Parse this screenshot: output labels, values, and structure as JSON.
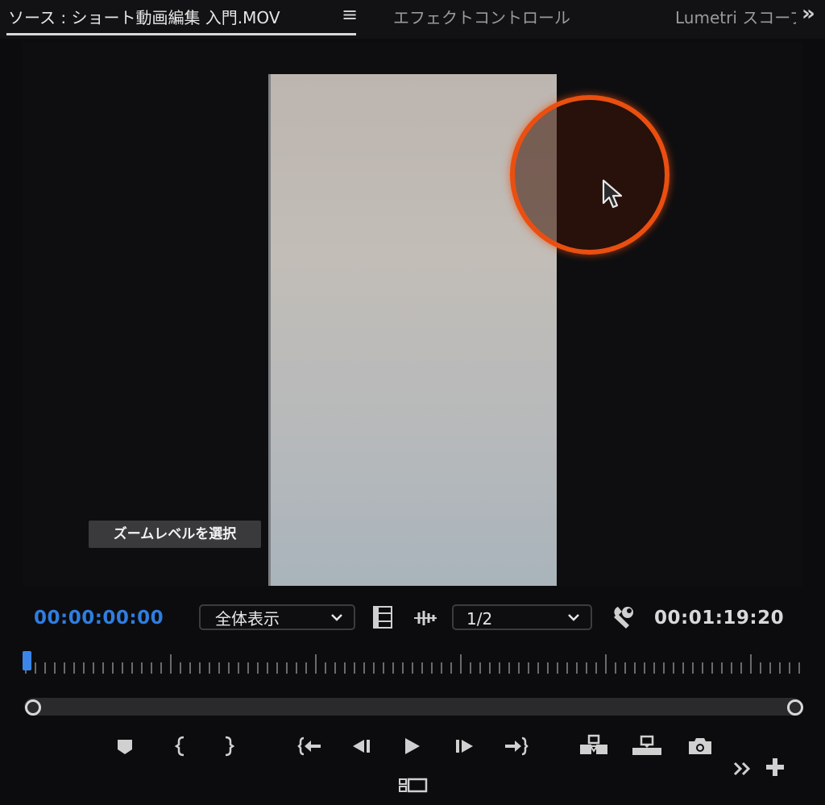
{
  "tabs": {
    "source": "ソース : ショート動画編集 入門.MOV",
    "menu_icon": "≡",
    "effect_controls": "エフェクトコントロール",
    "lumetri": "Lumetri スコープ",
    "overflow": "»"
  },
  "monitor": {
    "tooltip": "ズームレベルを選択",
    "highlight_color": "#ea4f10"
  },
  "controls": {
    "timecode_current": "00:00:00:00",
    "zoom_value": "全体表示",
    "resolution_value": "1/2",
    "timecode_duration": "00:01:19:20",
    "timecode_color": "#2f7de0"
  },
  "transport": {
    "icons": [
      "marker-icon",
      "mark-in-icon",
      "mark-out-icon",
      "go-to-in-icon",
      "step-back-icon",
      "play-icon",
      "step-forward-icon",
      "go-to-out-icon",
      "insert-icon",
      "overwrite-icon",
      "export-frame-icon",
      "comparison-view-icon",
      "overflow-icon",
      "add-button-icon"
    ]
  }
}
